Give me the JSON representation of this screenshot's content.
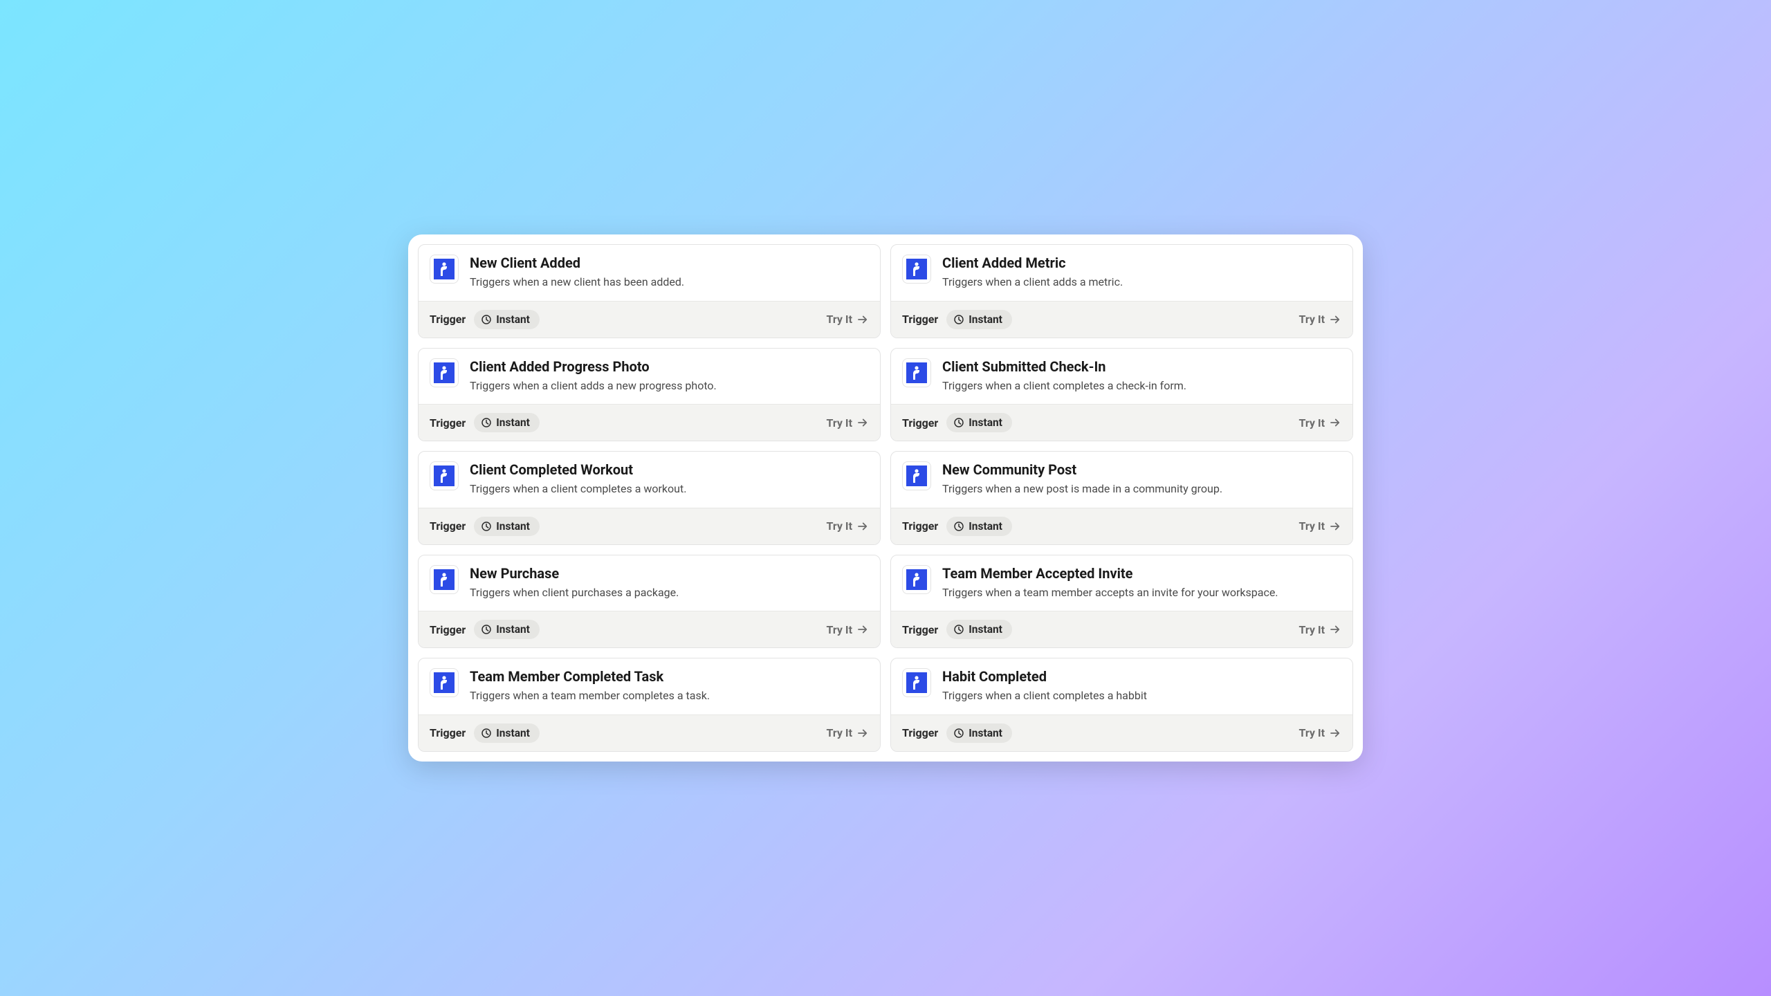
{
  "labels": {
    "type": "Trigger",
    "instant": "Instant",
    "try": "Try It"
  },
  "colors": {
    "brand_icon_bg": "#2c4be6"
  },
  "triggers": [
    {
      "title": "New Client Added",
      "desc": "Triggers when a new client has been added."
    },
    {
      "title": "Client Added Metric",
      "desc": "Triggers when a client adds a metric."
    },
    {
      "title": "Client Added Progress Photo",
      "desc": "Triggers when a client adds a new progress photo."
    },
    {
      "title": "Client Submitted Check-In",
      "desc": "Triggers when a client completes a check-in form."
    },
    {
      "title": "Client Completed Workout",
      "desc": "Triggers when a client completes a workout."
    },
    {
      "title": "New Community Post",
      "desc": "Triggers when a new post is made in a community group."
    },
    {
      "title": "New Purchase",
      "desc": "Triggers when client purchases a package."
    },
    {
      "title": "Team Member Accepted Invite",
      "desc": "Triggers when a team member accepts an invite for your workspace."
    },
    {
      "title": "Team Member Completed Task",
      "desc": "Triggers when a team member completes a task."
    },
    {
      "title": "Habit Completed",
      "desc": "Triggers when a client completes a habbit"
    }
  ]
}
